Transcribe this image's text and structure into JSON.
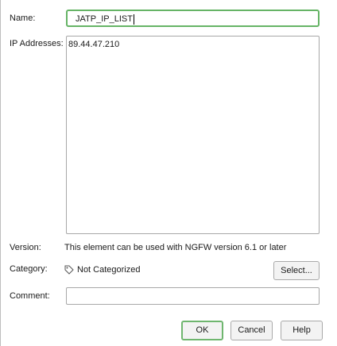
{
  "form": {
    "name_label": "Name:",
    "name_value": "JATP_IP_LIST",
    "ip_label": "IP Addresses:",
    "ip_value": "89.44.47.210",
    "version_label": "Version:",
    "version_text": "This element can be used with NGFW version 6.1 or later",
    "category_label": "Category:",
    "category_value": "Not Categorized",
    "category_icon": "tag-icon",
    "select_label": "Select...",
    "comment_label": "Comment:",
    "comment_value": ""
  },
  "buttons": {
    "ok": "OK",
    "cancel": "Cancel",
    "help": "Help"
  },
  "colors": {
    "focus_border": "#66b466",
    "field_border": "#a8a8a8"
  }
}
